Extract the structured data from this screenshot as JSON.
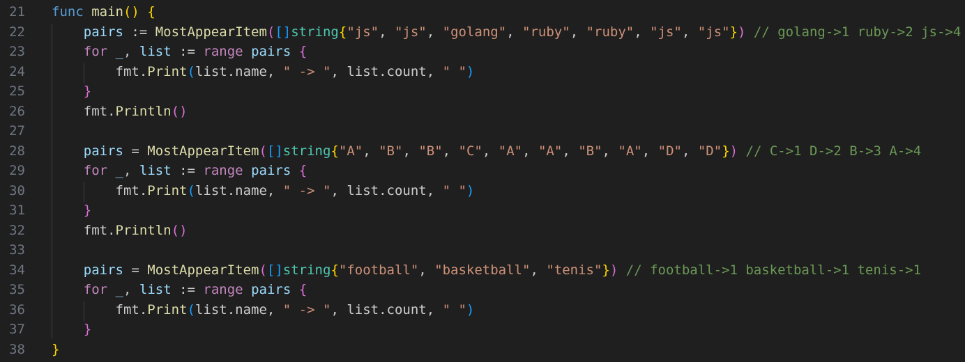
{
  "editor": {
    "colors": {
      "background": "#1f1f1f",
      "line_number": "#6e7681",
      "keyword": "#569cd6",
      "control": "#c586c0",
      "variable": "#9cdcfe",
      "function": "#dcdcaa",
      "type": "#4ec9b0",
      "string": "#ce9178",
      "comment": "#6a9955",
      "bracket_level_1": "#ffd700",
      "bracket_level_2": "#da70d6",
      "bracket_level_3": "#179fff"
    },
    "lines": [
      {
        "num": "21",
        "tokens": [
          {
            "t": "func",
            "c": "kw"
          },
          {
            "t": " ",
            "c": "pl"
          },
          {
            "t": "main",
            "c": "fn"
          },
          {
            "t": "()",
            "c": "b1"
          },
          {
            "t": " ",
            "c": "pl"
          },
          {
            "t": "{",
            "c": "b1"
          }
        ]
      },
      {
        "num": "22",
        "tokens": [
          {
            "t": "    ",
            "c": "pl"
          },
          {
            "t": "pairs",
            "c": "var"
          },
          {
            "t": " := ",
            "c": "pl"
          },
          {
            "t": "MostAppearItem",
            "c": "fn"
          },
          {
            "t": "(",
            "c": "b2"
          },
          {
            "t": "[]",
            "c": "b3"
          },
          {
            "t": "string",
            "c": "typ"
          },
          {
            "t": "{",
            "c": "b1"
          },
          {
            "t": "\"js\"",
            "c": "str"
          },
          {
            "t": ", ",
            "c": "pl"
          },
          {
            "t": "\"js\"",
            "c": "str"
          },
          {
            "t": ", ",
            "c": "pl"
          },
          {
            "t": "\"golang\"",
            "c": "str"
          },
          {
            "t": ", ",
            "c": "pl"
          },
          {
            "t": "\"ruby\"",
            "c": "str"
          },
          {
            "t": ", ",
            "c": "pl"
          },
          {
            "t": "\"ruby\"",
            "c": "str"
          },
          {
            "t": ", ",
            "c": "pl"
          },
          {
            "t": "\"js\"",
            "c": "str"
          },
          {
            "t": ", ",
            "c": "pl"
          },
          {
            "t": "\"js\"",
            "c": "str"
          },
          {
            "t": "}",
            "c": "b1"
          },
          {
            "t": ")",
            "c": "b2"
          },
          {
            "t": " // golang->1 ruby->2 js->4",
            "c": "com"
          }
        ]
      },
      {
        "num": "23",
        "tokens": [
          {
            "t": "    ",
            "c": "pl"
          },
          {
            "t": "for",
            "c": "ctl"
          },
          {
            "t": " ",
            "c": "pl"
          },
          {
            "t": "_",
            "c": "var"
          },
          {
            "t": ", ",
            "c": "pl"
          },
          {
            "t": "list",
            "c": "var"
          },
          {
            "t": " := ",
            "c": "pl"
          },
          {
            "t": "range",
            "c": "ctl"
          },
          {
            "t": " ",
            "c": "pl"
          },
          {
            "t": "pairs",
            "c": "var"
          },
          {
            "t": " ",
            "c": "pl"
          },
          {
            "t": "{",
            "c": "b2"
          }
        ]
      },
      {
        "num": "24",
        "tokens": [
          {
            "t": "        ",
            "c": "pl"
          },
          {
            "t": "fmt",
            "c": "pl"
          },
          {
            "t": ".",
            "c": "pl"
          },
          {
            "t": "Print",
            "c": "fn"
          },
          {
            "t": "(",
            "c": "b3"
          },
          {
            "t": "list",
            "c": "pl"
          },
          {
            "t": ".name, ",
            "c": "pl"
          },
          {
            "t": "\" -> \"",
            "c": "str"
          },
          {
            "t": ", list.count, ",
            "c": "pl"
          },
          {
            "t": "\" \"",
            "c": "str"
          },
          {
            "t": ")",
            "c": "b3"
          }
        ]
      },
      {
        "num": "25",
        "tokens": [
          {
            "t": "    ",
            "c": "pl"
          },
          {
            "t": "}",
            "c": "b2"
          }
        ]
      },
      {
        "num": "26",
        "tokens": [
          {
            "t": "    ",
            "c": "pl"
          },
          {
            "t": "fmt",
            "c": "pl"
          },
          {
            "t": ".",
            "c": "pl"
          },
          {
            "t": "Println",
            "c": "fn"
          },
          {
            "t": "()",
            "c": "b2"
          }
        ]
      },
      {
        "num": "27",
        "tokens": []
      },
      {
        "num": "28",
        "tokens": [
          {
            "t": "    ",
            "c": "pl"
          },
          {
            "t": "pairs",
            "c": "var"
          },
          {
            "t": " = ",
            "c": "pl"
          },
          {
            "t": "MostAppearItem",
            "c": "fn"
          },
          {
            "t": "(",
            "c": "b2"
          },
          {
            "t": "[]",
            "c": "b3"
          },
          {
            "t": "string",
            "c": "typ"
          },
          {
            "t": "{",
            "c": "b1"
          },
          {
            "t": "\"A\"",
            "c": "str"
          },
          {
            "t": ", ",
            "c": "pl"
          },
          {
            "t": "\"B\"",
            "c": "str"
          },
          {
            "t": ", ",
            "c": "pl"
          },
          {
            "t": "\"B\"",
            "c": "str"
          },
          {
            "t": ", ",
            "c": "pl"
          },
          {
            "t": "\"C\"",
            "c": "str"
          },
          {
            "t": ", ",
            "c": "pl"
          },
          {
            "t": "\"A\"",
            "c": "str"
          },
          {
            "t": ", ",
            "c": "pl"
          },
          {
            "t": "\"A\"",
            "c": "str"
          },
          {
            "t": ", ",
            "c": "pl"
          },
          {
            "t": "\"B\"",
            "c": "str"
          },
          {
            "t": ", ",
            "c": "pl"
          },
          {
            "t": "\"A\"",
            "c": "str"
          },
          {
            "t": ", ",
            "c": "pl"
          },
          {
            "t": "\"D\"",
            "c": "str"
          },
          {
            "t": ", ",
            "c": "pl"
          },
          {
            "t": "\"D\"",
            "c": "str"
          },
          {
            "t": "}",
            "c": "b1"
          },
          {
            "t": ")",
            "c": "b2"
          },
          {
            "t": " // C->1 D->2 B->3 A->4",
            "c": "com"
          }
        ]
      },
      {
        "num": "29",
        "tokens": [
          {
            "t": "    ",
            "c": "pl"
          },
          {
            "t": "for",
            "c": "ctl"
          },
          {
            "t": " ",
            "c": "pl"
          },
          {
            "t": "_",
            "c": "var"
          },
          {
            "t": ", ",
            "c": "pl"
          },
          {
            "t": "list",
            "c": "var"
          },
          {
            "t": " := ",
            "c": "pl"
          },
          {
            "t": "range",
            "c": "ctl"
          },
          {
            "t": " ",
            "c": "pl"
          },
          {
            "t": "pairs",
            "c": "var"
          },
          {
            "t": " ",
            "c": "pl"
          },
          {
            "t": "{",
            "c": "b2"
          }
        ]
      },
      {
        "num": "30",
        "tokens": [
          {
            "t": "        ",
            "c": "pl"
          },
          {
            "t": "fmt",
            "c": "pl"
          },
          {
            "t": ".",
            "c": "pl"
          },
          {
            "t": "Print",
            "c": "fn"
          },
          {
            "t": "(",
            "c": "b3"
          },
          {
            "t": "list",
            "c": "pl"
          },
          {
            "t": ".name, ",
            "c": "pl"
          },
          {
            "t": "\" -> \"",
            "c": "str"
          },
          {
            "t": ", list.count, ",
            "c": "pl"
          },
          {
            "t": "\" \"",
            "c": "str"
          },
          {
            "t": ")",
            "c": "b3"
          }
        ]
      },
      {
        "num": "31",
        "tokens": [
          {
            "t": "    ",
            "c": "pl"
          },
          {
            "t": "}",
            "c": "b2"
          }
        ]
      },
      {
        "num": "32",
        "tokens": [
          {
            "t": "    ",
            "c": "pl"
          },
          {
            "t": "fmt",
            "c": "pl"
          },
          {
            "t": ".",
            "c": "pl"
          },
          {
            "t": "Println",
            "c": "fn"
          },
          {
            "t": "()",
            "c": "b2"
          }
        ]
      },
      {
        "num": "33",
        "tokens": []
      },
      {
        "num": "34",
        "tokens": [
          {
            "t": "    ",
            "c": "pl"
          },
          {
            "t": "pairs",
            "c": "var"
          },
          {
            "t": " = ",
            "c": "pl"
          },
          {
            "t": "MostAppearItem",
            "c": "fn"
          },
          {
            "t": "(",
            "c": "b2"
          },
          {
            "t": "[]",
            "c": "b3"
          },
          {
            "t": "string",
            "c": "typ"
          },
          {
            "t": "{",
            "c": "b1"
          },
          {
            "t": "\"football\"",
            "c": "str"
          },
          {
            "t": ", ",
            "c": "pl"
          },
          {
            "t": "\"basketball\"",
            "c": "str"
          },
          {
            "t": ", ",
            "c": "pl"
          },
          {
            "t": "\"tenis\"",
            "c": "str"
          },
          {
            "t": "}",
            "c": "b1"
          },
          {
            "t": ")",
            "c": "b2"
          },
          {
            "t": " // football->1 basketball->1 tenis->1",
            "c": "com"
          }
        ]
      },
      {
        "num": "35",
        "tokens": [
          {
            "t": "    ",
            "c": "pl"
          },
          {
            "t": "for",
            "c": "ctl"
          },
          {
            "t": " ",
            "c": "pl"
          },
          {
            "t": "_",
            "c": "var"
          },
          {
            "t": ", ",
            "c": "pl"
          },
          {
            "t": "list",
            "c": "var"
          },
          {
            "t": " := ",
            "c": "pl"
          },
          {
            "t": "range",
            "c": "ctl"
          },
          {
            "t": " ",
            "c": "pl"
          },
          {
            "t": "pairs",
            "c": "var"
          },
          {
            "t": " ",
            "c": "pl"
          },
          {
            "t": "{",
            "c": "b2"
          }
        ]
      },
      {
        "num": "36",
        "tokens": [
          {
            "t": "        ",
            "c": "pl"
          },
          {
            "t": "fmt",
            "c": "pl"
          },
          {
            "t": ".",
            "c": "pl"
          },
          {
            "t": "Print",
            "c": "fn"
          },
          {
            "t": "(",
            "c": "b3"
          },
          {
            "t": "list",
            "c": "pl"
          },
          {
            "t": ".name, ",
            "c": "pl"
          },
          {
            "t": "\" -> \"",
            "c": "str"
          },
          {
            "t": ", list.count, ",
            "c": "pl"
          },
          {
            "t": "\" \"",
            "c": "str"
          },
          {
            "t": ")",
            "c": "b3"
          }
        ]
      },
      {
        "num": "37",
        "tokens": [
          {
            "t": "    ",
            "c": "pl"
          },
          {
            "t": "}",
            "c": "b2"
          }
        ]
      },
      {
        "num": "38",
        "tokens": [
          {
            "t": "}",
            "c": "b1"
          }
        ]
      }
    ]
  }
}
